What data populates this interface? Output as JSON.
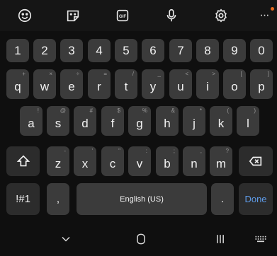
{
  "toolbar": {
    "icons": [
      "emoji-icon",
      "sticker-icon",
      "gif-icon",
      "microphone-icon",
      "settings-icon",
      "more-icon"
    ],
    "gif_label": "GIF",
    "more_label": "···",
    "accent_dot_color": "#e8681d"
  },
  "rows": {
    "numbers": [
      "1",
      "2",
      "3",
      "4",
      "5",
      "6",
      "7",
      "8",
      "9",
      "0"
    ],
    "row1": [
      {
        "key": "q",
        "hint": "+"
      },
      {
        "key": "w",
        "hint": "×"
      },
      {
        "key": "e",
        "hint": "÷"
      },
      {
        "key": "r",
        "hint": "="
      },
      {
        "key": "t",
        "hint": "/"
      },
      {
        "key": "y",
        "hint": "_"
      },
      {
        "key": "u",
        "hint": "<"
      },
      {
        "key": "i",
        "hint": ">"
      },
      {
        "key": "o",
        "hint": "["
      },
      {
        "key": "p",
        "hint": "]"
      }
    ],
    "row2": [
      {
        "key": "a",
        "hint": "!"
      },
      {
        "key": "s",
        "hint": "@"
      },
      {
        "key": "d",
        "hint": "#"
      },
      {
        "key": "f",
        "hint": "$"
      },
      {
        "key": "g",
        "hint": "%"
      },
      {
        "key": "h",
        "hint": "&"
      },
      {
        "key": "j",
        "hint": "*"
      },
      {
        "key": "k",
        "hint": "("
      },
      {
        "key": "l",
        "hint": ")"
      }
    ],
    "row3": [
      {
        "key": "z",
        "hint": "-"
      },
      {
        "key": "x",
        "hint": "'"
      },
      {
        "key": "c",
        "hint": "\""
      },
      {
        "key": "v",
        "hint": ":"
      },
      {
        "key": "b",
        "hint": ";"
      },
      {
        "key": "n",
        "hint": ","
      },
      {
        "key": "m",
        "hint": "?"
      }
    ]
  },
  "bottom_row": {
    "symbols_label": "!#1",
    "comma_label": ",",
    "space_label": "English (US)",
    "period_label": ".",
    "done_label": "Done",
    "done_color": "#5e9be8"
  },
  "navbar": {
    "icons": [
      "chevron-down-icon",
      "home-icon",
      "recents-icon",
      "keyboard-icon"
    ]
  }
}
